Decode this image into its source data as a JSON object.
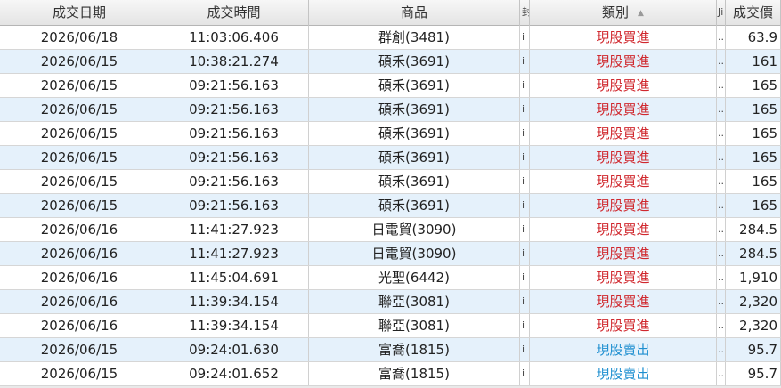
{
  "colors": {
    "buy": "#d0282e",
    "sell": "#1e8fd0",
    "row_alt": "#e5f1fb"
  },
  "columns": {
    "date": "成交日期",
    "time": "成交時間",
    "product": "商品",
    "col3": "封",
    "type": "類別",
    "col5": "Ji",
    "price": "成交價"
  },
  "sort_icon": "sort-ascending-icon",
  "rows": [
    {
      "date": "2026/06/18",
      "time": "11:03:06.406",
      "product": "群創(3481)",
      "col3": "i",
      "type": "現股買進",
      "side": "buy",
      "col5": "..",
      "price": "63.9"
    },
    {
      "date": "2026/06/15",
      "time": "10:38:21.274",
      "product": "碩禾(3691)",
      "col3": "i",
      "type": "現股買進",
      "side": "buy",
      "col5": "..",
      "price": "161"
    },
    {
      "date": "2026/06/15",
      "time": "09:21:56.163",
      "product": "碩禾(3691)",
      "col3": "i",
      "type": "現股買進",
      "side": "buy",
      "col5": "..",
      "price": "165"
    },
    {
      "date": "2026/06/15",
      "time": "09:21:56.163",
      "product": "碩禾(3691)",
      "col3": "i",
      "type": "現股買進",
      "side": "buy",
      "col5": "..",
      "price": "165"
    },
    {
      "date": "2026/06/15",
      "time": "09:21:56.163",
      "product": "碩禾(3691)",
      "col3": "i",
      "type": "現股買進",
      "side": "buy",
      "col5": "..",
      "price": "165"
    },
    {
      "date": "2026/06/15",
      "time": "09:21:56.163",
      "product": "碩禾(3691)",
      "col3": "i",
      "type": "現股買進",
      "side": "buy",
      "col5": "..",
      "price": "165"
    },
    {
      "date": "2026/06/15",
      "time": "09:21:56.163",
      "product": "碩禾(3691)",
      "col3": "i",
      "type": "現股買進",
      "side": "buy",
      "col5": "..",
      "price": "165"
    },
    {
      "date": "2026/06/15",
      "time": "09:21:56.163",
      "product": "碩禾(3691)",
      "col3": "i",
      "type": "現股買進",
      "side": "buy",
      "col5": "..",
      "price": "165"
    },
    {
      "date": "2026/06/16",
      "time": "11:41:27.923",
      "product": "日電貿(3090)",
      "col3": "i",
      "type": "現股買進",
      "side": "buy",
      "col5": "..",
      "price": "284.5"
    },
    {
      "date": "2026/06/16",
      "time": "11:41:27.923",
      "product": "日電貿(3090)",
      "col3": "i",
      "type": "現股買進",
      "side": "buy",
      "col5": "..",
      "price": "284.5"
    },
    {
      "date": "2026/06/16",
      "time": "11:45:04.691",
      "product": "光聖(6442)",
      "col3": "i",
      "type": "現股買進",
      "side": "buy",
      "col5": "..",
      "price": "1,910"
    },
    {
      "date": "2026/06/16",
      "time": "11:39:34.154",
      "product": "聯亞(3081)",
      "col3": "i",
      "type": "現股買進",
      "side": "buy",
      "col5": "..",
      "price": "2,320"
    },
    {
      "date": "2026/06/16",
      "time": "11:39:34.154",
      "product": "聯亞(3081)",
      "col3": "i",
      "type": "現股買進",
      "side": "buy",
      "col5": "..",
      "price": "2,320"
    },
    {
      "date": "2026/06/15",
      "time": "09:24:01.630",
      "product": "富喬(1815)",
      "col3": "i",
      "type": "現股賣出",
      "side": "sell",
      "col5": "..",
      "price": "95.7"
    },
    {
      "date": "2026/06/15",
      "time": "09:24:01.652",
      "product": "富喬(1815)",
      "col3": "i",
      "type": "現股賣出",
      "side": "sell",
      "col5": "..",
      "price": "95.7"
    }
  ]
}
